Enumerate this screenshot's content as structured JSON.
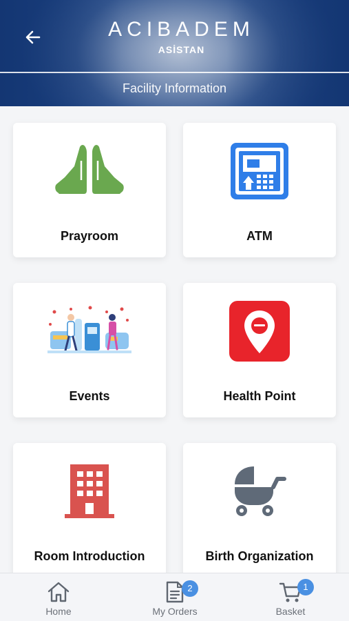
{
  "header": {
    "brand_name": "ACIBADEM",
    "brand_sub": "ASİSTAN",
    "page_title": "Facility Information",
    "back_icon": "arrow-left-icon"
  },
  "cards": [
    {
      "label": "Prayroom",
      "icon": "praying-hands-icon",
      "color": "#6aa84f"
    },
    {
      "label": "ATM",
      "icon": "atm-icon",
      "color": "#2f7ee8"
    },
    {
      "label": "Events",
      "icon": "events-illustration-icon",
      "color": "#3a8fd6"
    },
    {
      "label": "Health Point",
      "icon": "map-pin-icon",
      "color": "#e8242b"
    },
    {
      "label": "Room Introduction",
      "icon": "building-icon",
      "color": "#d9534f"
    },
    {
      "label": "Birth Organization",
      "icon": "baby-stroller-icon",
      "color": "#5f6a78"
    }
  ],
  "bottom_nav": {
    "home": {
      "label": "Home",
      "icon": "home-icon"
    },
    "orders": {
      "label": "My Orders",
      "icon": "document-icon",
      "badge": "2"
    },
    "basket": {
      "label": "Basket",
      "icon": "cart-icon",
      "badge": "1"
    }
  },
  "colors": {
    "header_blue": "#1d4383",
    "badge_blue": "#4a90e2"
  }
}
